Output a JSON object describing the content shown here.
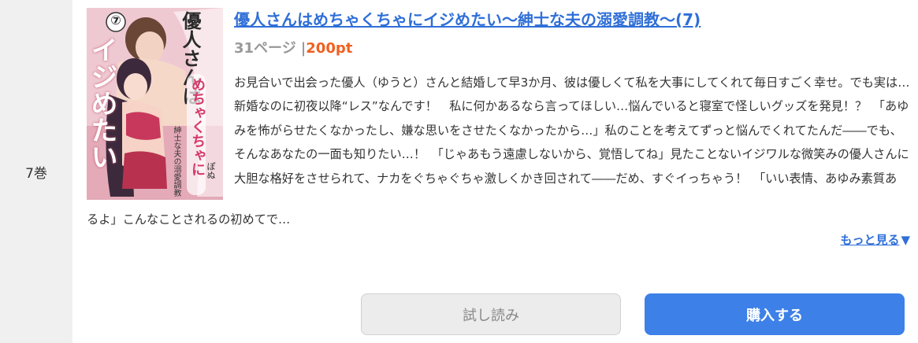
{
  "volume": {
    "label": "7巻"
  },
  "book": {
    "cover_alt": "優人さんはめちゃくちゃにイジめたい 表紙",
    "cover_texts": {
      "number": "⑦",
      "vertical_title_a": "優人さんは",
      "vertical_title_b": "めちゃくちゃに",
      "vertical_title_c": "イジめたい",
      "subtitle": "紳士な夫の溺愛調教",
      "author": "ぽぬ"
    },
    "title": "優人さんはめちゃくちゃにイジめたい〜紳士な夫の溺愛調教〜(7)",
    "pages": "31ページ",
    "separator": "|",
    "price": "200pt",
    "description_part1": "お見合いで出会った優人（ゆうと）さんと結婚して早3か月、彼は優しくて私を大事にしてくれて毎日すごく幸せ。でも実は…新婚なのに初夜以降“レス”なんです！　私に何かあるなら言ってほしい…悩んでいると寝室で怪しいグッズを発見！？　「あゆみを怖がらせたくなかったし、嫌な思いをさせたくなかったから…」私のことを考えてずっと悩んでくれてたんだ――でも、そんなあなたの一面も知りたい…！　「じゃあもう遠慮しないから、覚悟してね」見たことないイジワルな微笑みの優人さんに大胆な格好をさせられて、ナカをぐちゃぐちゃ激しくかき回されて――だめ、すぐイっちゃう！　「いい表情、あゆみ素質あ",
    "description_part2": "るよ」こんなことされるの初めてで…"
  },
  "actions": {
    "more_label": "もっと見る",
    "more_icon": "▼",
    "trial_label": "試し読み",
    "buy_label": "購入する"
  },
  "colors": {
    "link": "#2f6fd8",
    "price": "#f06020",
    "buy_button": "#3c80e8",
    "trial_button": "#ececec",
    "volume_column": "#f0f0f0"
  }
}
